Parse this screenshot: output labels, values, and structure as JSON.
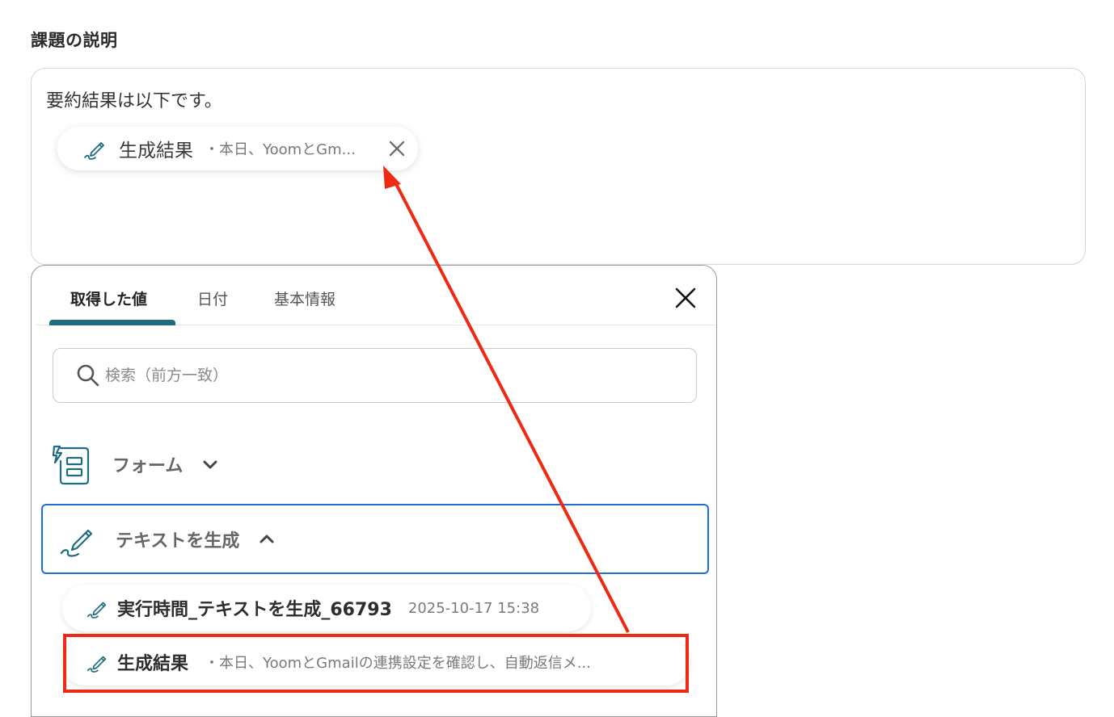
{
  "section": {
    "title": "課題の説明"
  },
  "text_area": {
    "line": "要約結果は以下です。",
    "chip": {
      "label": "生成結果",
      "preview": "・本日、YoomとGm..."
    }
  },
  "panel": {
    "tabs": [
      "取得した値",
      "日付",
      "基本情報"
    ],
    "search": {
      "placeholder": "検索（前方一致）"
    },
    "groups": [
      {
        "label": "フォーム",
        "icon": "form-icon",
        "expanded": false
      },
      {
        "label": "テキストを生成",
        "icon": "pen-icon",
        "expanded": true
      }
    ],
    "items": [
      {
        "label": "実行時間_テキストを生成_66793",
        "value": "2025-10-17 15:38"
      },
      {
        "label": "生成結果",
        "value": "・本日、YoomとGmailの連携設定を確認し、自動返信メ..."
      }
    ]
  },
  "colors": {
    "accent": "#1f6b80",
    "focus_border": "#1f6fcf",
    "annotation": "#ee2a14"
  }
}
